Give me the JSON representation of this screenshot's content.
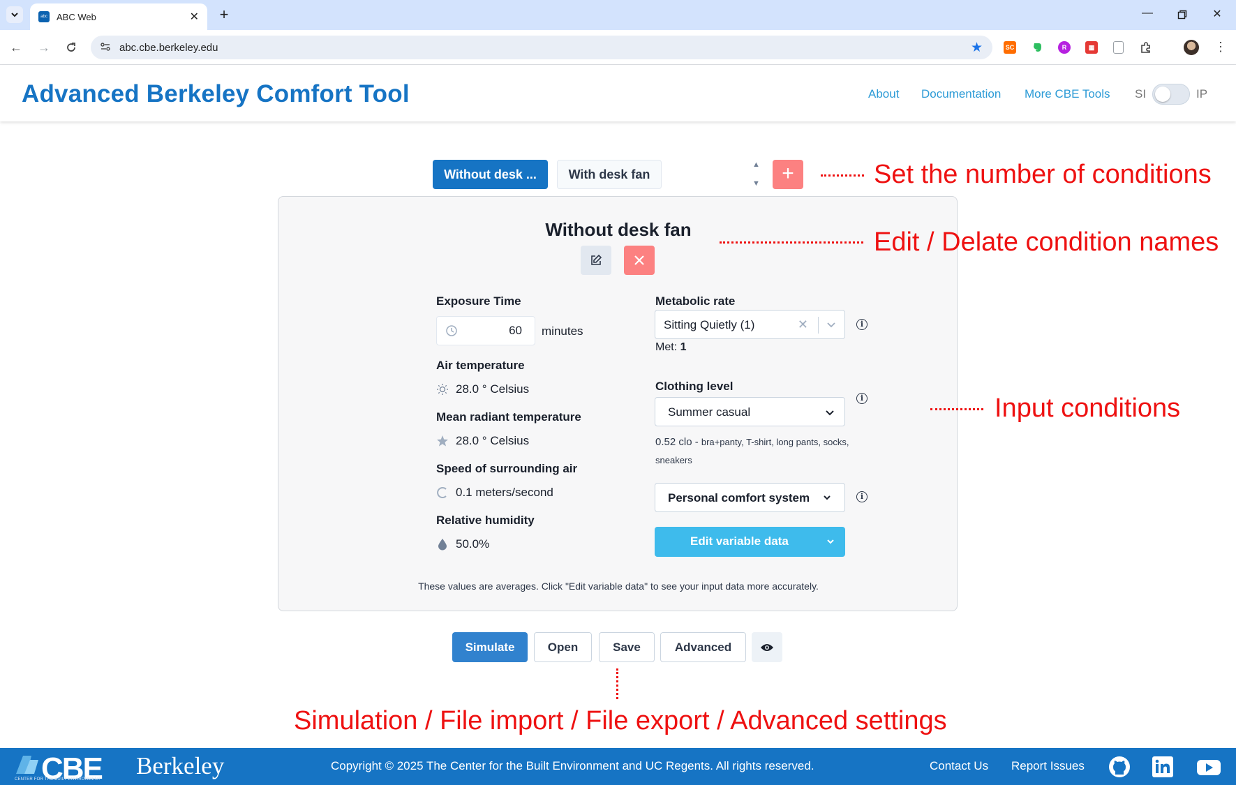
{
  "browser": {
    "tab_title": "ABC Web",
    "favicon_text": "abc",
    "url": "abc.cbe.berkeley.edu",
    "extensions": [
      {
        "name": "sc-extension-icon",
        "label": "SC",
        "color": "#ff6d00"
      },
      {
        "name": "evernote-icon",
        "label": "",
        "color": "#2dbe60"
      },
      {
        "name": "purple-extension-icon",
        "label": "R",
        "color": "#b620e0"
      },
      {
        "name": "red-extension-icon",
        "label": "",
        "color": "#e53935"
      }
    ]
  },
  "header": {
    "title": "Advanced Berkeley Comfort Tool",
    "links": [
      "About",
      "Documentation",
      "More CBE Tools"
    ],
    "unit_si": "SI",
    "unit_ip": "IP"
  },
  "conditions": {
    "tabs": [
      "Without desk ...",
      "With desk fan"
    ],
    "add_label": "+"
  },
  "card": {
    "title": "Without desk fan",
    "exposure": {
      "label": "Exposure Time",
      "value": "60",
      "unit": "minutes"
    },
    "air_temp": {
      "label": "Air temperature",
      "value": "28.0 ° Celsius"
    },
    "mrt": {
      "label": "Mean radiant temperature",
      "value": "28.0 ° Celsius"
    },
    "air_speed": {
      "label": "Speed of surrounding air",
      "value": "0.1 meters/second"
    },
    "humidity": {
      "label": "Relative humidity",
      "value": "50.0%"
    },
    "metabolic": {
      "label": "Metabolic rate",
      "selected": "Sitting Quietly (1)",
      "met_label": "Met:",
      "met_value": "1"
    },
    "clothing": {
      "label": "Clothing level",
      "selected": "Summer casual",
      "clo_value": "0.52 clo -",
      "clo_desc": "bra+panty, T-shirt, long pants, socks, sneakers"
    },
    "pcs": {
      "selected": "Personal comfort system"
    },
    "edit_variable": "Edit variable data",
    "note": "These values are averages. Click \"Edit variable data\" to see your input data more accurately."
  },
  "actions": {
    "simulate": "Simulate",
    "open": "Open",
    "save": "Save",
    "advanced": "Advanced"
  },
  "annotations": {
    "conditions_count": "Set the number of conditions",
    "edit_delete": "Edit / Delate condition names",
    "inputs": "Input conditions",
    "bottom": "Simulation / File import / File export / Advanced settings"
  },
  "footer": {
    "cbe_logo": "CBE",
    "cbe_sub": "CENTER FOR THE BUILT ENVIRONMENT",
    "berkeley": "Berkeley",
    "copyright": "Copyright © 2025 The Center for the Built Environment and UC Regents. All rights reserved.",
    "contact": "Contact Us",
    "report": "Report Issues"
  },
  "colors": {
    "brand": "#1674c4",
    "accent_red": "#fc8181",
    "edit_variable_blue": "#3ebbec",
    "annotation_red": "#ee1111"
  }
}
